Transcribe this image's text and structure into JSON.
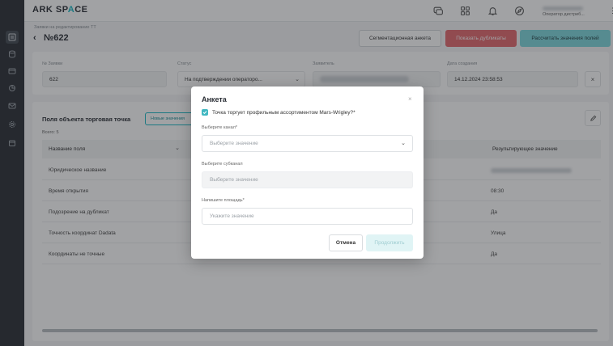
{
  "app": {
    "logo_main": "ARK SP",
    "logo_accent": "A",
    "logo_tail": "CE",
    "user_role": "Оператор дистриб...",
    "user_menu": "⋮"
  },
  "header": {
    "breadcrumb": "Заявки на редактирование ТТ",
    "back_glyph": "‹",
    "title": "№622",
    "btn_segment": "Сегментационная анкета",
    "btn_duplicates": "Показать дубликаты",
    "btn_calc": "Рассчитать значения полей"
  },
  "fields": {
    "request_no_label": "№ Заявки",
    "request_no_value": "622",
    "status_label": "Статус",
    "status_value": "На подтверждении операторо...",
    "applicant_label": "Заявитель",
    "created_label": "Дата создания",
    "created_value": "14.12.2024 23:58:53",
    "clear_glyph": "×"
  },
  "section": {
    "title": "Поля объекта торговая точка",
    "new_values_btn": "Новые значения",
    "total": "Всего: 5",
    "col_field": "Название поля",
    "col_result": "Результирующее значение",
    "rows": [
      {
        "name": "Юридическое название",
        "result": ""
      },
      {
        "name": "Время открытия",
        "result": "08:30"
      },
      {
        "name": "Подозрение на дубликат",
        "result": "Да"
      },
      {
        "name": "Точность координат Dadata",
        "result": "Улица"
      },
      {
        "name": "Координаты не точные",
        "result": "Да"
      }
    ]
  },
  "modal": {
    "title": "Анкета",
    "close_glyph": "×",
    "checkbox_label": "Точка торгует профильным ассортиментом Mars-Wrigley?*",
    "channel_label": "Выберите канал*",
    "channel_placeholder": "Выберите значение",
    "subchannel_label": "Выберите субканал",
    "subchannel_placeholder": "Выберите значение",
    "area_label": "Напишите площадь*",
    "area_placeholder": "Укажите значение",
    "cancel": "Отмена",
    "continue": "Продолжить"
  },
  "icons": {
    "chevron": "⌄"
  },
  "colors": {
    "accent": "#1bb8c4",
    "danger": "#e36a6f",
    "rail": "#2b2f36"
  }
}
